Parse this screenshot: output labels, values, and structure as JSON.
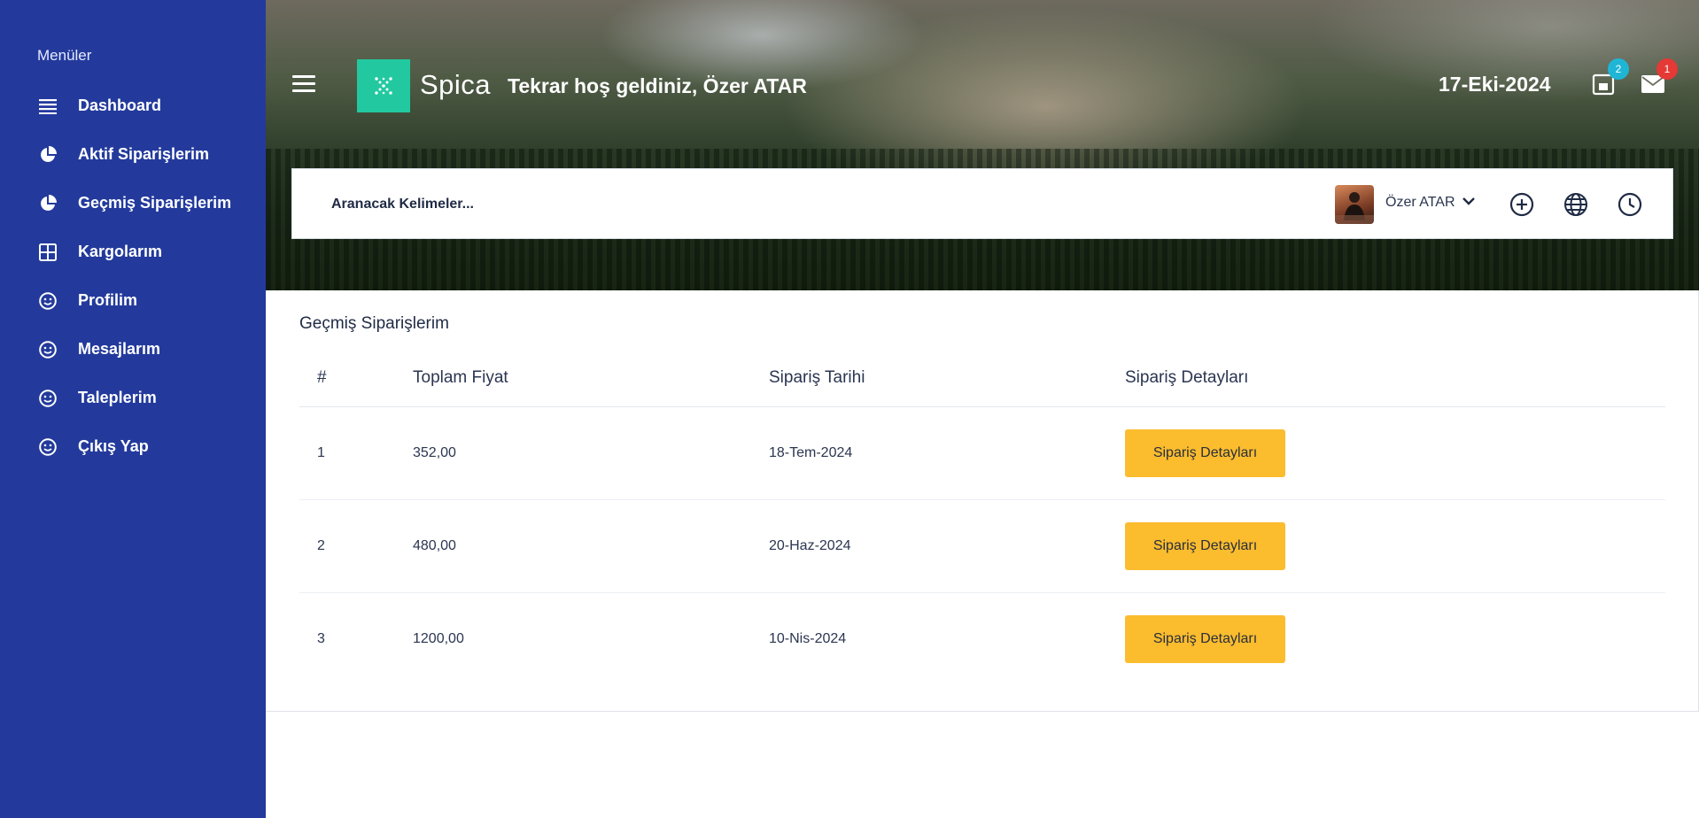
{
  "sidebar": {
    "menu_title": "Menüler",
    "items": [
      {
        "label": "Dashboard",
        "icon": "list-icon"
      },
      {
        "label": "Aktif Siparişlerim",
        "icon": "pie-chart-icon"
      },
      {
        "label": "Geçmiş Siparişlerim",
        "icon": "pie-chart-icon"
      },
      {
        "label": "Kargolarım",
        "icon": "grid-icon"
      },
      {
        "label": "Profilim",
        "icon": "smiley-icon"
      },
      {
        "label": "Mesajlarım",
        "icon": "smiley-icon"
      },
      {
        "label": "Taleplerim",
        "icon": "smiley-icon"
      },
      {
        "label": "Çıkış Yap",
        "icon": "smiley-icon"
      }
    ]
  },
  "header": {
    "brand": "Spica",
    "welcome": "Tekrar hoş geldiniz, Özer ATAR",
    "date": "17-Eki-2024",
    "cart_badge": "2",
    "mail_badge": "1"
  },
  "search": {
    "placeholder": "Aranacak Kelimeler...",
    "user_name": "Özer ATAR"
  },
  "orders": {
    "title": "Geçmiş Siparişlerim",
    "columns": [
      "#",
      "Toplam Fiyat",
      "Sipariş Tarihi",
      "Sipariş Detayları"
    ],
    "rows": [
      {
        "no": "1",
        "total": "352,00",
        "date": "18-Tem-2024",
        "button": "Sipariş Detayları"
      },
      {
        "no": "2",
        "total": "480,00",
        "date": "20-Haz-2024",
        "button": "Sipariş Detayları"
      },
      {
        "no": "3",
        "total": "1200,00",
        "date": "10-Nis-2024",
        "button": "Sipariş Detayları"
      }
    ]
  },
  "colors": {
    "sidebar": "#233a9c",
    "logo": "#22c9a0",
    "button": "#fbbc2e",
    "badge_cart": "#1fb6d6",
    "badge_mail": "#e53935"
  }
}
